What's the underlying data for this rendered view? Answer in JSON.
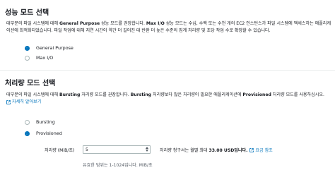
{
  "perf_mode": {
    "title": "성능 모드 선택",
    "desc_1": "대부분의 파일 시스템에 대해 ",
    "desc_bold_1": "General Purpose",
    "desc_2": " 성능 모드를 권장합니다. ",
    "desc_bold_2": "Max I/O",
    "desc_3": " 성능 모드는 수십, 수백 또는 수천 개의 EC2 인스턴스가 파일 시스템에 액세스하는 애플리케이션에 최적화되었습니다. 파일 작업에 대해 지연 시간이 약간 더 길어진 대 반환 더 높은 수준의 집계 처리량 및 초당 작업 수로 확장할 수 있습니다.",
    "options": [
      {
        "label": "General Purpose",
        "selected": true
      },
      {
        "label": "Max I/O",
        "selected": false
      }
    ]
  },
  "throughput_mode": {
    "title": "처리량 모드 선택",
    "desc_1": "대부분의 파일 시스템에 대해 ",
    "desc_bold_1": "Bursting",
    "desc_2": " 처리량 모드를 권장합니다. ",
    "desc_bold_2": "Bursting",
    "desc_3": " 처리량보다 많은 처리량이 필요한 애플리케이션에 ",
    "desc_bold_3": "Provisioned",
    "desc_4": " 처리량 모드를 사용하십시오.",
    "learn_more": "자세히 알아보기",
    "options": [
      {
        "label": "Bursting",
        "selected": false
      },
      {
        "label": "Provisioned",
        "selected": true
      }
    ],
    "throughput_label": "처리량 (MiB/초)",
    "throughput_value": "5",
    "price_note_prefix": "처리량 청구서는 월별 최대",
    "price_amount": "33.00 USD입니다.",
    "price_link": "요금 참조",
    "hint": "유효한 범위는 1-1024입니다. MiB/초"
  },
  "colors": {
    "accent": "#0073bb",
    "text": "#16191f",
    "muted": "#545b64",
    "divider": "#eaeded"
  },
  "icons": {
    "external_link": "external-link-icon"
  }
}
